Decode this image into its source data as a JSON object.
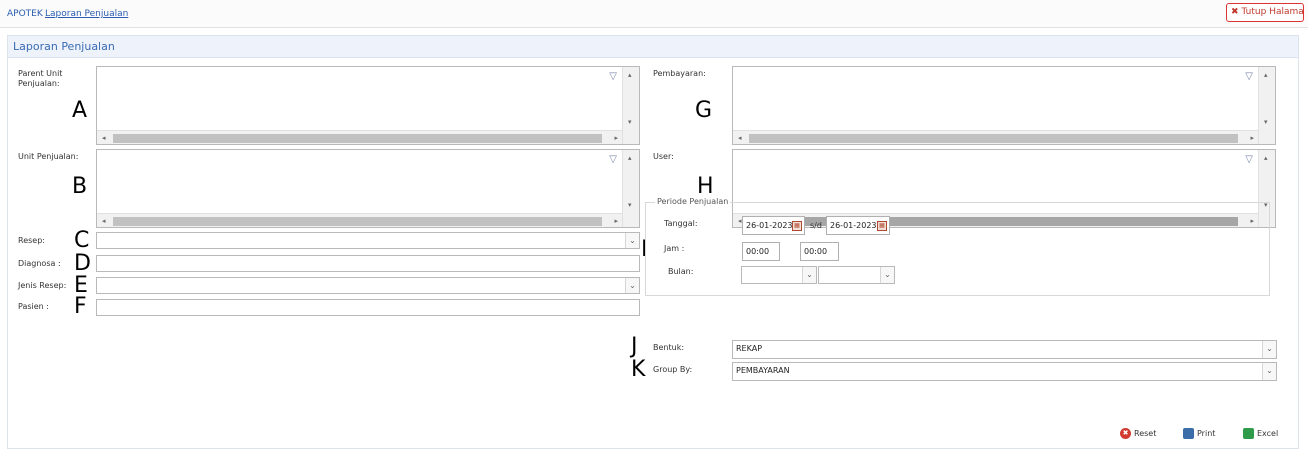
{
  "breadcrumb": {
    "app": "APOTEK",
    "page": "Laporan Penjualan"
  },
  "close_button": {
    "label": "Tutup Halaman",
    "icon": "close-icon"
  },
  "panel": {
    "title": "Laporan Penjualan"
  },
  "fields": {
    "parent_unit": {
      "label": "Parent Unit Penjualan:",
      "marker": "A"
    },
    "unit": {
      "label": "Unit Penjualan:",
      "marker": "B"
    },
    "resep": {
      "label": "Resep:",
      "marker": "C",
      "value": ""
    },
    "diagnosa": {
      "label": "Diagnosa :",
      "marker": "D",
      "value": ""
    },
    "jenis_resep": {
      "label": "Jenis Resep:",
      "marker": "E",
      "value": ""
    },
    "pasien": {
      "label": "Pasien :",
      "marker": "F",
      "value": ""
    },
    "pembayaran": {
      "label": "Pembayaran:",
      "marker": "G"
    },
    "user": {
      "label": "User:",
      "marker": "H"
    }
  },
  "periode": {
    "legend": "Periode Penjualan",
    "marker": "I",
    "tanggal_label": "Tanggal:",
    "date_from": "26-01-2023",
    "separator": "s/d",
    "date_to": "26-01-2023",
    "jam_label": "Jam :",
    "time_from": "00:00",
    "time_to": "00:00",
    "bulan_label": "Bulan:"
  },
  "bentuk": {
    "label": "Bentuk:",
    "marker": "J",
    "value": "REKAP"
  },
  "group_by": {
    "label": "Group By:",
    "marker": "K",
    "value": "PEMBAYARAN"
  },
  "actions": {
    "reset": "Reset",
    "print": "Print",
    "excel": "Excel"
  },
  "glyphs": {
    "funnel": "▽",
    "chevron": "⌄",
    "left": "◂",
    "right": "▸",
    "up": "▴",
    "down": "▾",
    "x": "✖",
    "cal": "▦"
  }
}
